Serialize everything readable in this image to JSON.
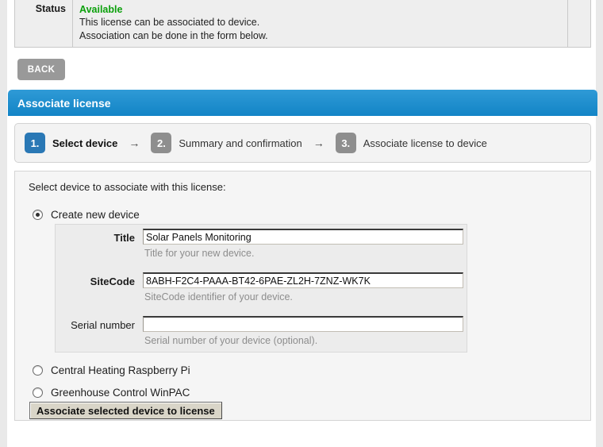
{
  "status": {
    "label": "Status",
    "value": "Available",
    "line1": "This license can be associated to device.",
    "line2": "Association can be done in the form below.",
    "value_color": "#0ba00b"
  },
  "back_button": {
    "label": "BACK"
  },
  "header": {
    "title": "Associate license",
    "accent_color": "#1284c6"
  },
  "stepper": {
    "arrow": "→",
    "steps": [
      {
        "number": "1.",
        "label": "Select device",
        "state": "active"
      },
      {
        "number": "2.",
        "label": "Summary and confirmation",
        "state": "idle"
      },
      {
        "number": "3.",
        "label": "Associate license to device",
        "state": "idle"
      }
    ]
  },
  "main": {
    "intro": "Select device to associate with this license:",
    "options": [
      {
        "label": "Create new device",
        "selected": true
      },
      {
        "label": "Central Heating Raspberry Pi",
        "selected": false
      },
      {
        "label": "Greenhouse Control WinPAC",
        "selected": false
      }
    ],
    "fields": [
      {
        "label": "Title",
        "value": "Solar Panels Monitoring",
        "placeholder": "",
        "hint": "Title for your new device."
      },
      {
        "label": "SiteCode",
        "value": "8ABH-F2C4-PAAA-BT42-6PAE-ZL2H-7ZNZ-WK7K",
        "placeholder": "",
        "hint": "SiteCode identifier of your device."
      },
      {
        "label": "Serial number",
        "value": "",
        "placeholder": "",
        "hint": "Serial number of your device (optional)."
      }
    ],
    "submit_label": "Associate selected device to license"
  }
}
